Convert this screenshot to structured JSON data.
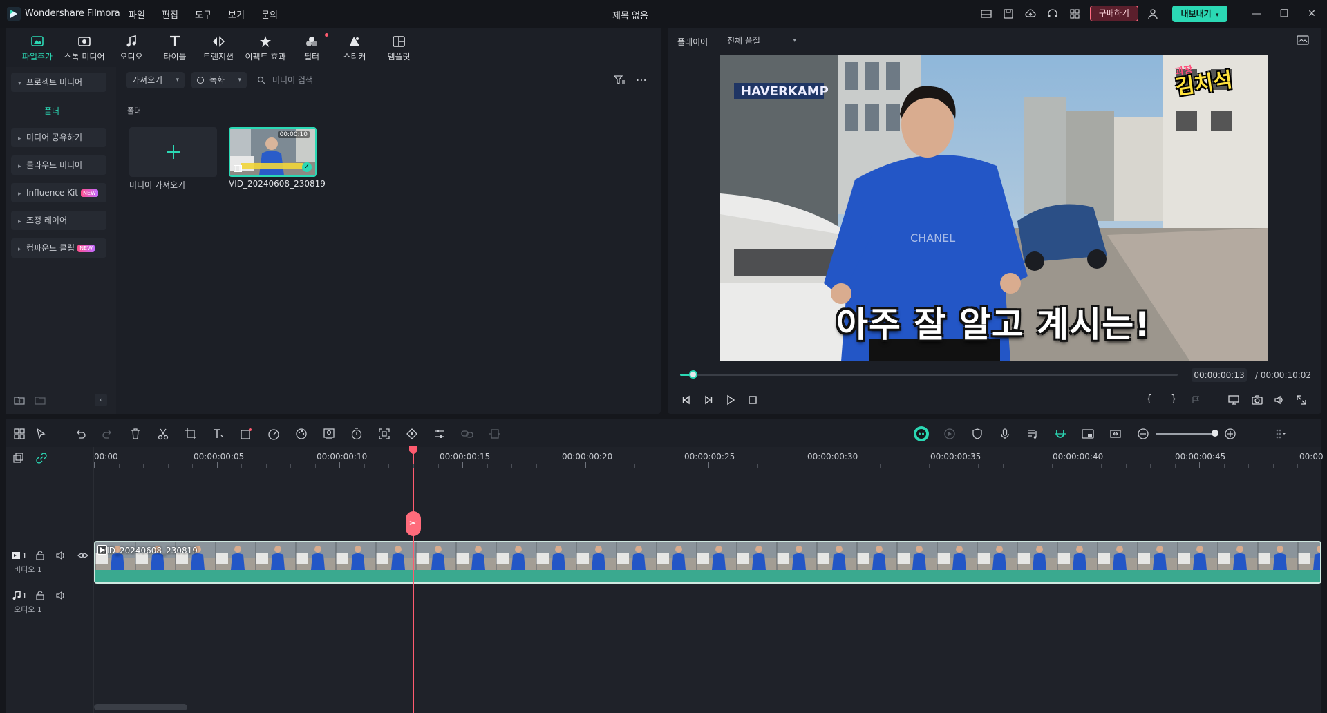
{
  "titlebar": {
    "app_name": "Wondershare Filmora",
    "menus": [
      "파일",
      "편집",
      "도구",
      "보기",
      "문의"
    ],
    "document_title": "제목 없음",
    "buy_label": "구매하기",
    "export_label": "내보내기",
    "accent": "#2bd8b4"
  },
  "tool_tabs": [
    {
      "label": "파일추가",
      "icon": "media-icon",
      "active": true
    },
    {
      "label": "스톡 미디어",
      "icon": "stock-media-icon"
    },
    {
      "label": "오디오",
      "icon": "music-note-icon"
    },
    {
      "label": "타이틀",
      "icon": "title-t-icon"
    },
    {
      "label": "트랜지션",
      "icon": "transition-icon"
    },
    {
      "label": "이펙트 효과",
      "icon": "effects-icon"
    },
    {
      "label": "필터",
      "icon": "filter-icon"
    },
    {
      "label": "스티커",
      "icon": "sticker-icon"
    },
    {
      "label": "템플릿",
      "icon": "template-icon"
    }
  ],
  "sidebar": {
    "items": [
      {
        "label": "프로젝트 미디어"
      },
      {
        "label": "미디어 공유하기"
      },
      {
        "label": "클라우드 미디어"
      },
      {
        "label": "Influence Kit",
        "badge": "NEW"
      },
      {
        "label": "조정 레이어"
      },
      {
        "label": "컴파운드 클립",
        "badge": "NEW"
      }
    ],
    "folder_label": "폴더"
  },
  "media": {
    "import_dropdown": "가져오기",
    "record_dropdown": "녹화",
    "search_placeholder": "미디어 검색",
    "folder_heading": "폴더",
    "import_tile_label": "미디어 가져오기",
    "clip": {
      "name": "VID_20240608_230819",
      "duration": "00:00:10"
    }
  },
  "player": {
    "label": "플레이어",
    "quality": "전체 품질",
    "current_time": "00:00:00:13",
    "total_time": "/ 00:00:10:02",
    "subtitle": "아주 잘 알고 계시는!",
    "sticker_top": "과장",
    "sticker_main": "김치석",
    "progress": 0.02
  },
  "timeline": {
    "ruler_labels": [
      "00:00",
      "00:00:00:05",
      "00:00:00:10",
      "00:00:00:15",
      "00:00:00:20",
      "00:00:00:25",
      "00:00:00:30",
      "00:00:00:35",
      "00:00:00:40",
      "00:00:00:45",
      "00:00"
    ],
    "video_track": {
      "number": "1",
      "label": "비디오 1",
      "clip_title": "VID_20240608_230819"
    },
    "audio_track": {
      "number": "1",
      "label": "오디오 1"
    }
  }
}
